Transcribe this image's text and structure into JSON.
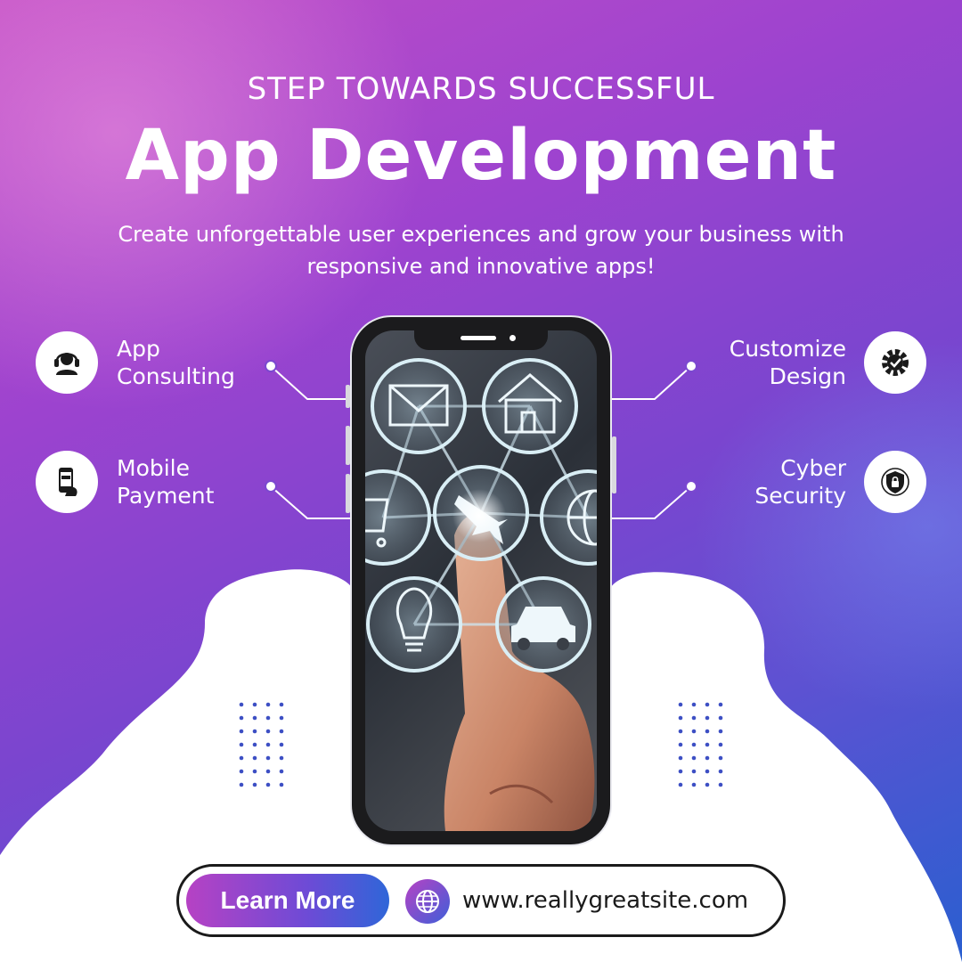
{
  "header": {
    "subtitle": "STEP TOWARDS SUCCESSFUL",
    "title": "App Development",
    "description": "Create unforgettable user experiences and grow your business with responsive and innovative apps!"
  },
  "features": {
    "app_consulting": {
      "line1": "App",
      "line2": "Consulting",
      "icon": "headset-person-icon"
    },
    "mobile_payment": {
      "line1": "Mobile",
      "line2": "Payment",
      "icon": "phone-payment-icon"
    },
    "customize_design": {
      "line1": "Customize",
      "line2": "Design",
      "icon": "gear-check-icon"
    },
    "cyber_security": {
      "line1": "Cyber",
      "line2": "Security",
      "icon": "shield-lock-icon"
    }
  },
  "cta": {
    "button_label": "Learn More",
    "website": "www.reallygreatsite.com",
    "globe_icon": "globe-icon"
  },
  "colors": {
    "accent_purple": "#b642c4",
    "accent_blue": "#2f66d8",
    "text_dark": "#1a1a1a"
  }
}
